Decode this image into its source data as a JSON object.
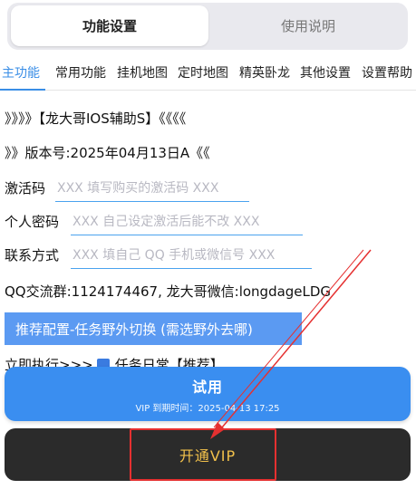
{
  "top_tabs": [
    "功能设置",
    "使用说明"
  ],
  "sub_tabs": [
    "主功能",
    "常用功能",
    "挂机地图",
    "定时地图",
    "精英卧龙",
    "其他设置",
    "设置帮助"
  ],
  "lines": {
    "banner": "》》》》【龙大哥IOS辅助S】《《《《",
    "version": "》》版本号:2025年04月13日A《《"
  },
  "fields": [
    {
      "label": "激活码",
      "placeholder": "XXX 填写购买的激活码 XXX",
      "value": ""
    },
    {
      "label": "个人密码",
      "placeholder": "XXX 自己设定激活后能不改 XXX",
      "value": ""
    },
    {
      "label": "联系方式",
      "placeholder": "XXX 填自己 QQ 手机或微信号 XXX",
      "value": ""
    }
  ],
  "contact_line": "QQ交流群:1124174467, 龙大哥微信:longdageLDG",
  "recommend_button": "推荐配置-任务野外切换 (需选野外去哪)",
  "exec_row": {
    "prefix": "立即执行>>>",
    "checked": true,
    "label": "任务日常【推荐】"
  },
  "trial": {
    "label": "试用",
    "expiry": "VIP 到期时间：2025-04-13 17:25"
  },
  "vip_button": "开通VIP",
  "colors": {
    "accent": "#3a8ee6",
    "trial_bg": "#3a8ef0",
    "vip_bg": "#2b2b2b",
    "vip_text": "#f2c14b",
    "annotation": "#e53030"
  }
}
